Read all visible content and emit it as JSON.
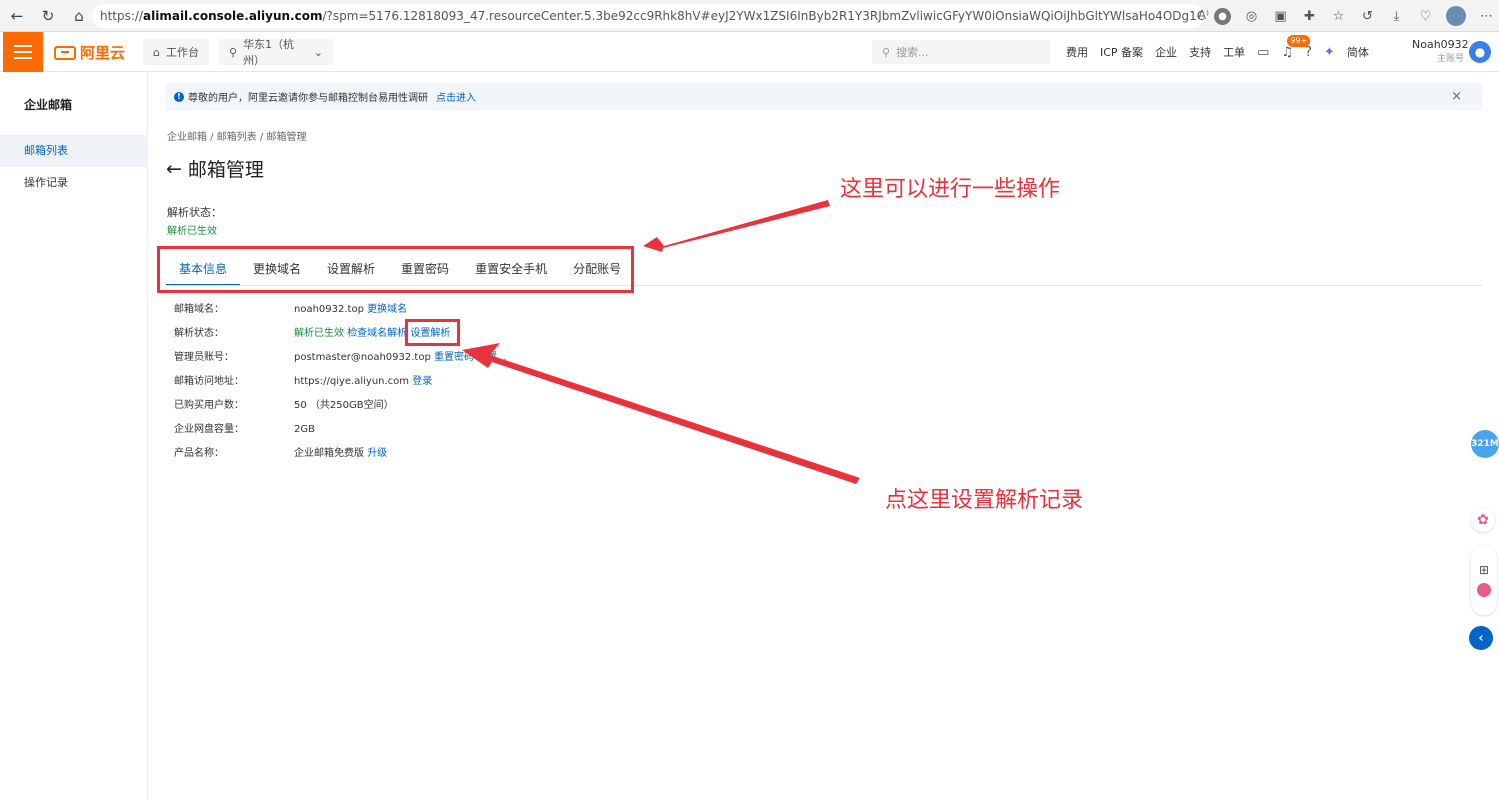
{
  "browser": {
    "url_prefix": "https://",
    "url_host": "alimail.console.aliyun.com",
    "url_rest": "/?spm=5176.12818093_47.resourceCenter.5.3be92cc9Rhk8hV#eyJ2YWx1ZSI6InByb2R1Y3RJbmZvliwicGFyYW0iOnsiaWQiOiJhbGltYWlsaHo4ODg1ODVmODNkNDg0ODdiYTU4...",
    "read_aloud": "A⁾",
    "back_icon": "←",
    "reload_icon": "↻",
    "home_icon": "⌂",
    "menu_dots": "⋯"
  },
  "header": {
    "workbench": "工作台",
    "region": "华东1（杭州）",
    "search_placeholder": "搜索...",
    "links": [
      "费用",
      "ICP 备案",
      "企业",
      "支持",
      "工单"
    ],
    "notification_badge": "99+",
    "language": "简体",
    "user_name": "Noah0932",
    "user_role": "主账号"
  },
  "sidebar": {
    "title": "企业邮箱",
    "items": [
      {
        "label": "邮箱列表",
        "active": true
      },
      {
        "label": "操作记录",
        "active": false
      }
    ]
  },
  "notice": {
    "text": "尊敬的用户，阿里云邀请你参与邮箱控制台易用性调研",
    "link": "点击进入",
    "close": "×"
  },
  "breadcrumb": "企业邮箱 / 邮箱列表 / 邮箱管理",
  "page": {
    "title": "邮箱管理",
    "back": "←",
    "status_label": "解析状态：",
    "status_value": "解析已生效"
  },
  "tabs": [
    "基本信息",
    "更换域名",
    "设置解析",
    "重置密码",
    "重置安全手机",
    "分配账号"
  ],
  "info": {
    "domain": {
      "label": "邮箱域名：",
      "value": "noah0932.top",
      "action": "更换域名"
    },
    "dns": {
      "label": "解析状态：",
      "value": "解析已生效",
      "action1": "检查域名解析",
      "action2": "设置解析"
    },
    "admin": {
      "label": "管理员账号：",
      "value": "postmaster@noah0932.top",
      "action1": "重置密码",
      "action2": "重置..."
    },
    "access": {
      "label": "邮箱访问地址：",
      "value": "https://qiye.aliyun.com",
      "action": "登录"
    },
    "users": {
      "label": "已购买用户数：",
      "value": "50  （共250GB空间）"
    },
    "disk": {
      "label": "企业网盘容量：",
      "value": "2GB"
    },
    "product": {
      "label": "产品名称：",
      "value": "企业邮箱免费版",
      "action": "升级"
    }
  },
  "annotations": {
    "top": "这里可以进行一些操作",
    "bottom": "点这里设置解析记录"
  },
  "floating": {
    "speed": "321M"
  },
  "colors": {
    "brand": "#ff6a00",
    "link": "#0064c8",
    "success": "#1e8e3e",
    "annotation": "#e8323c"
  }
}
